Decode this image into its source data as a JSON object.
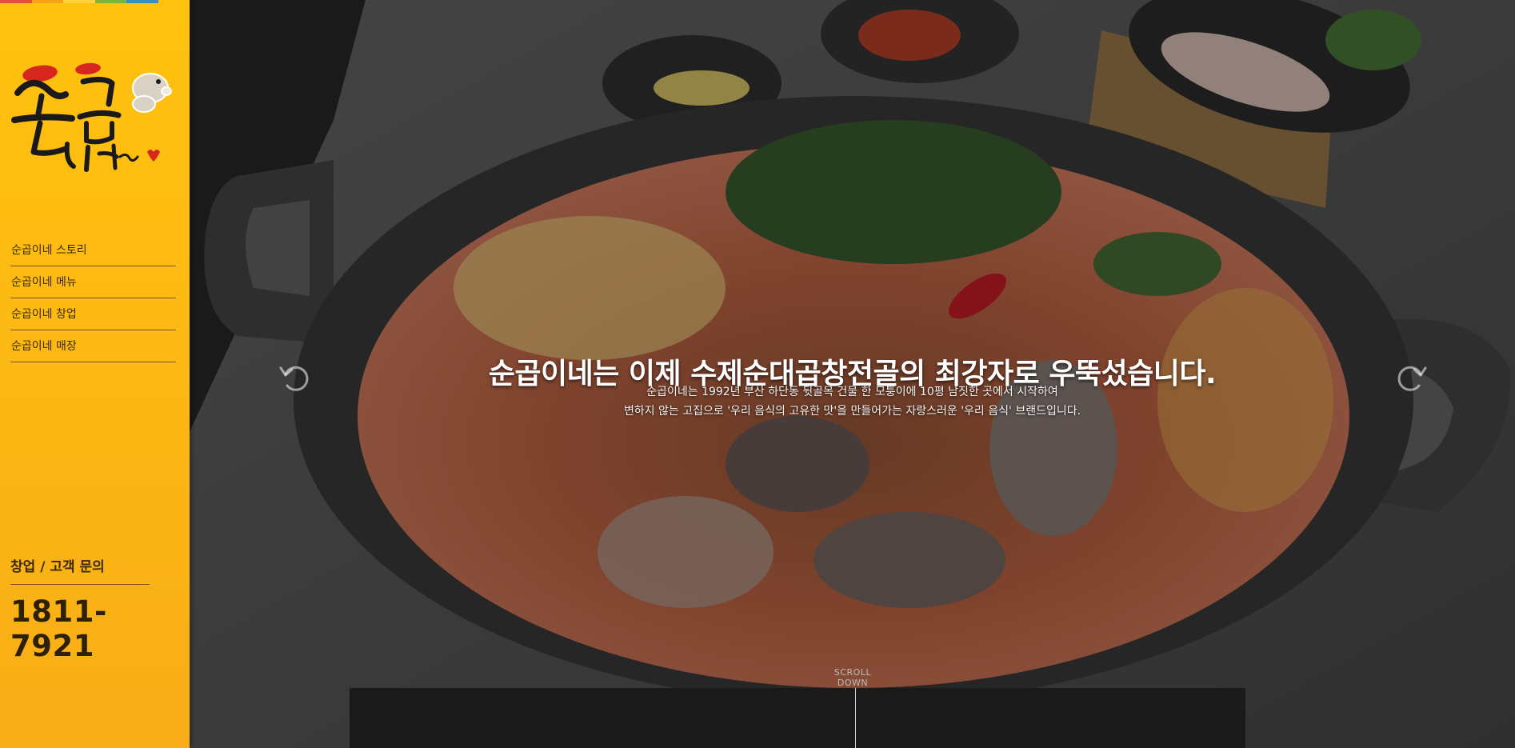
{
  "brand": {
    "logo_text": "순곱이네~",
    "top_strip_colors": [
      "#e94b3c",
      "#f6a21b",
      "#ffd23f",
      "#7fb241",
      "#3a8fc2",
      "#ffc20e"
    ]
  },
  "sidebar": {
    "background": "#fdb913",
    "nav_items": [
      {
        "label": "순곱이네 스토리"
      },
      {
        "label": "순곱이네 메뉴"
      },
      {
        "label": "순곱이네 창업"
      },
      {
        "label": "순곱이네 매장"
      }
    ],
    "contact": {
      "label": "창업 / 고객 문의",
      "phone": "1811-7921"
    }
  },
  "hero": {
    "headline": "순곱이네는 이제 수제순대곱창전골의 최강자로 우뚝섰습니다.",
    "description_lines": [
      "순곱이네는 1992년 부산 하단동 뒷골목 건물 한 모퉁이에 10평 남짓한 곳에서 시작하여",
      "변하지 않는 고집으로 '우리 음식의 고유한 맛'을 만들어가는 자랑스러운 '우리 음식' 브랜드입니다."
    ],
    "prev_icon": "rotate-left-icon",
    "next_icon": "rotate-right-icon",
    "scroll_label": "SCROLL DOWN"
  }
}
